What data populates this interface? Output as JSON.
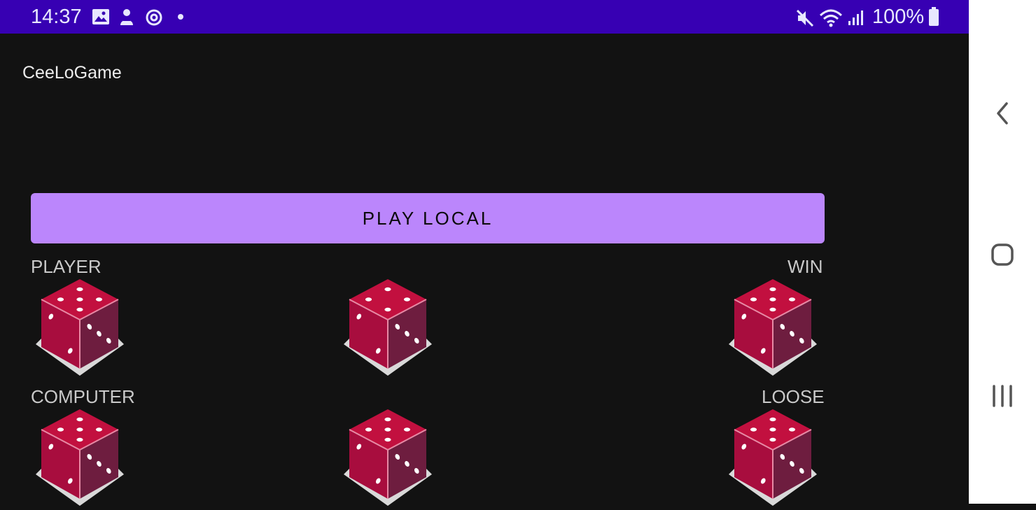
{
  "status_bar": {
    "time": "14:37",
    "battery": "100%",
    "left_icons": [
      "gallery-icon",
      "notification-icon",
      "sync-icon",
      "dot-icon"
    ],
    "right_icons": [
      "mute-icon",
      "wifi-icon",
      "signal-icon",
      "battery-icon"
    ]
  },
  "app": {
    "title": "CeeLoGame"
  },
  "play_button": {
    "label": "PLAY LOCAL"
  },
  "player": {
    "label": "PLAYER",
    "result": "WIN",
    "dice": [
      5,
      4,
      5
    ]
  },
  "computer": {
    "label": "COMPUTER",
    "result": "LOOSE",
    "dice": [
      5,
      5,
      5
    ]
  },
  "nav": {
    "icons": [
      "back-icon",
      "home-icon",
      "recents-icon"
    ]
  },
  "colors": {
    "status_bar": "#3700b3",
    "background": "#121212",
    "accent": "#bb86fc",
    "die": "#c2103f"
  }
}
